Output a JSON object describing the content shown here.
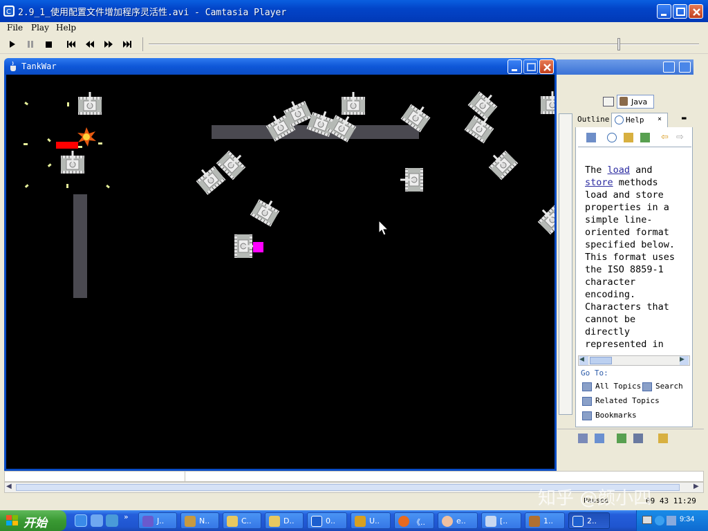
{
  "window": {
    "title": "2.9_1_使用配置文件增加程序灵活性.avi - Camtasia Player",
    "menu": [
      "File",
      "Play",
      "Help"
    ]
  },
  "player": {
    "controls": [
      "play-icon",
      "pause-icon",
      "stop-icon",
      "skip-start-icon",
      "rewind-icon",
      "fast-forward-icon",
      "skip-end-icon"
    ],
    "progress": 0.85
  },
  "tankwar": {
    "title": "TankWar"
  },
  "eclipse": {
    "perspective_label": "Java",
    "tabs": [
      "Outline",
      "Help"
    ],
    "help_text": [
      "The ",
      "load",
      " and ",
      "store",
      " methods load and store properties in a simple line-oriented format specified below. This format uses the ISO 8859-1 character encoding. Characters that cannot be directly represented in this encoding can"
    ],
    "goto_label": "Go To:",
    "links": {
      "all_topics": "All Topics",
      "search": "Search",
      "related_topics": "Related Topics",
      "bookmarks": "Bookmarks"
    }
  },
  "status": {
    "paused": "Paused",
    "time": "09 43 11:29"
  },
  "watermark": "知乎 @颜小四",
  "taskbar": {
    "start_label": "开始",
    "items": [
      "J..",
      "N..",
      "C..",
      "D..",
      "0..",
      "U..",
      "《..",
      "e..",
      "[..",
      "1..",
      "2.."
    ],
    "clock": "9:34"
  },
  "colors": {
    "xp_blue": "#0a5fe0",
    "game_bg": "#000000",
    "wall": "#4a4950",
    "player_tank_health": "#ff0000",
    "item": "#ff00ff"
  }
}
